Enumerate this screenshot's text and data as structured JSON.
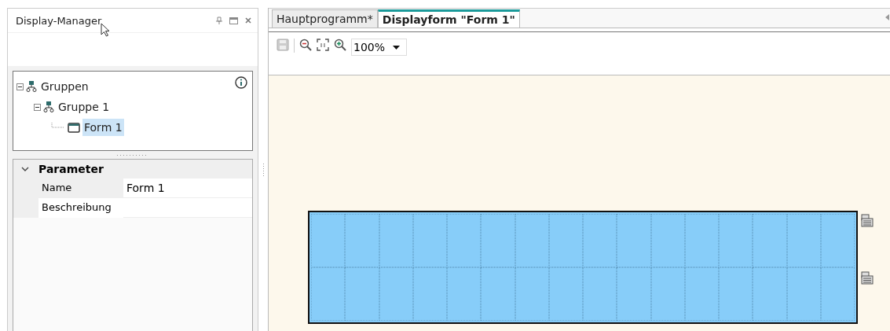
{
  "panel": {
    "title": "Display-Manager"
  },
  "tree": [
    {
      "label": "Gruppen",
      "kind": "group",
      "expanded": true,
      "selected": false,
      "children": [
        {
          "label": "Gruppe 1",
          "kind": "group",
          "expanded": true,
          "selected": false,
          "children": [
            {
              "label": "Form 1",
              "kind": "form",
              "selected": true
            }
          ]
        }
      ]
    }
  ],
  "properties": {
    "section": "Parameter",
    "expanded": true,
    "rows": [
      {
        "name": "Name",
        "value": "Form 1"
      },
      {
        "name": "Beschreibung"
      }
    ]
  },
  "tabs": [
    {
      "label": "Hauptprogramm*",
      "selected": false
    },
    {
      "label": "Displayform \"Form 1\"",
      "selected": true
    }
  ],
  "toolbar": {
    "zoom": "100%"
  }
}
